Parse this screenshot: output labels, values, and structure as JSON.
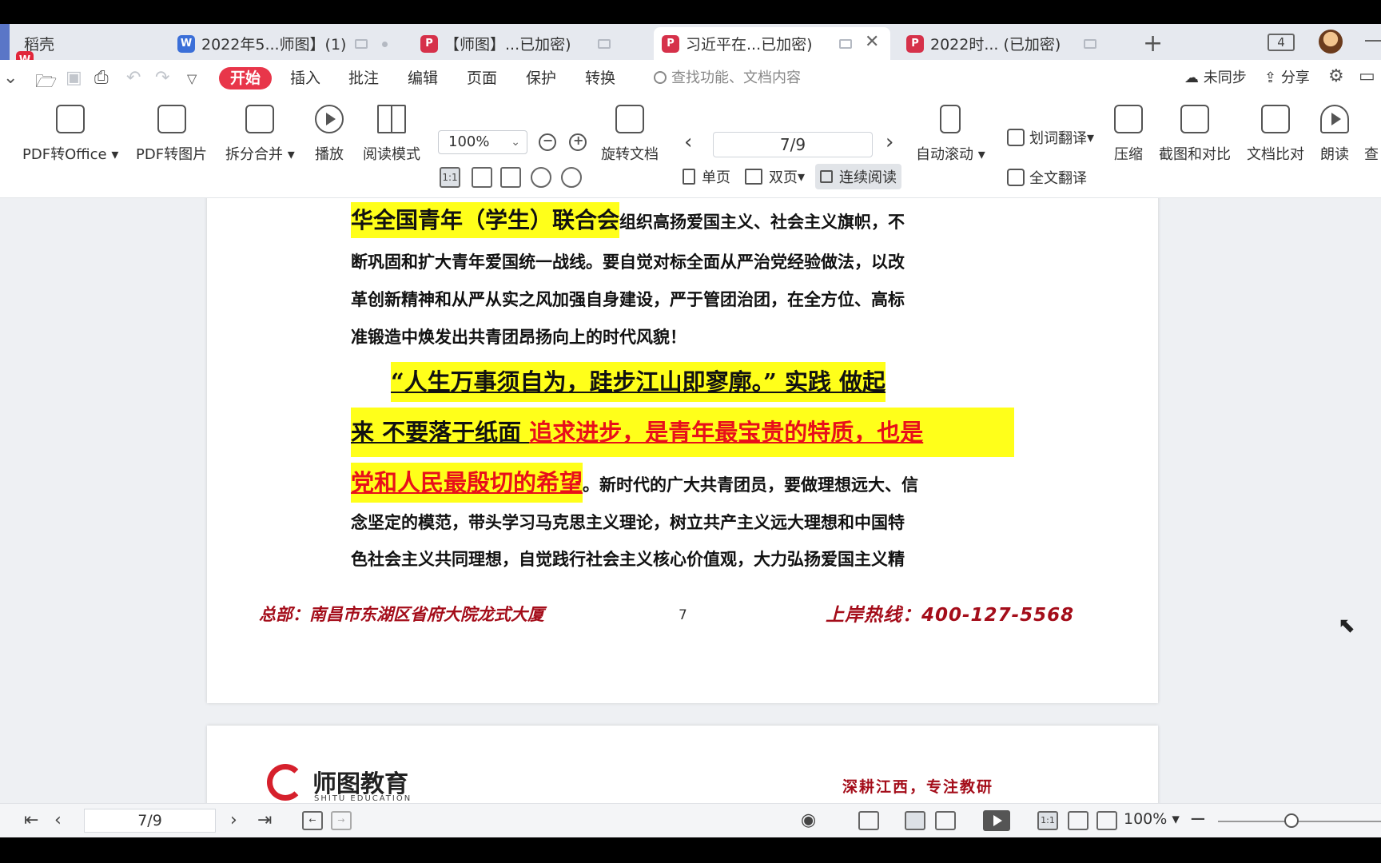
{
  "tabs": [
    {
      "label": "稻壳",
      "icon": "daoke-app-icon"
    },
    {
      "label": "2022年5...师图】(1)",
      "icon": "word-doc-icon"
    },
    {
      "label": "【师图】...已加密)",
      "icon": "pdf-icon"
    },
    {
      "label": "习近平在...已加密)",
      "icon": "pdf-icon",
      "active": true
    },
    {
      "label": "2022时... (已加密)",
      "icon": "pdf-icon"
    }
  ],
  "window": {
    "tab_count": "4"
  },
  "menu": {
    "items": [
      "开始",
      "插入",
      "批注",
      "编辑",
      "页面",
      "保护",
      "转换"
    ],
    "active": "开始",
    "search_placeholder": "查找功能、文档内容",
    "sync_label": "未同步",
    "share_label": "分享"
  },
  "ribbon": {
    "pdf_to_office": "PDF转Office",
    "pdf_to_image": "PDF转图片",
    "split_merge": "拆分合并",
    "play": "播放",
    "read_mode": "阅读模式",
    "zoom": "100%",
    "actual_size": "1:1",
    "rotate_doc": "旋转文档",
    "page_indicator": "7/9",
    "single_page": "单页",
    "double_page": "双页",
    "continuous_read": "连续阅读",
    "auto_scroll": "自动滚动",
    "word_translate": "划词翻译",
    "full_translate": "全文翻译",
    "compress": "压缩",
    "screenshot_compare": "截图和对比",
    "doc_compare": "文档比对",
    "read_aloud": "朗读",
    "more_cut": "查"
  },
  "document": {
    "lines": [
      {
        "segments": [
          {
            "text": "华全国青年（学生）联合会",
            "style": "hl big"
          },
          {
            "text": "组织高扬爱国主义、社会主义旗帜，不",
            "style": "normal"
          }
        ]
      },
      {
        "segments": [
          {
            "text": "断巩固和扩大青年爱国统一战线。要自觉对标全面从严治党经验做法，以改",
            "style": "normal"
          }
        ]
      },
      {
        "segments": [
          {
            "text": "革创新精神和从严从实之风加强自身建设，严于管团治团，在全方位、高标",
            "style": "normal"
          }
        ]
      },
      {
        "segments": [
          {
            "text": "准锻造中焕发出共青团昂扬向上的时代风貌！",
            "style": "normal"
          }
        ]
      },
      {
        "segments": [
          {
            "text": "“人生万事须自为，跬步江山即寥廓。”  实践 做起",
            "style": "hl big ul"
          }
        ]
      },
      {
        "segments": [
          {
            "text": "来 不要落于纸面 ",
            "style": "hl big ul"
          },
          {
            "text": "追求进步，是青年最宝贵的特质，也是",
            "style": "hl big ul red"
          }
        ]
      },
      {
        "segments": [
          {
            "text": "党和人民最殷切的希望",
            "style": "hl big ul red"
          },
          {
            "text": "。新时代的广大共青团员，要做理想远大、信",
            "style": "normal"
          }
        ]
      },
      {
        "segments": [
          {
            "text": "念坚定的模范，带头学习马克思主义理论，树立共产主义远大理想和中国特",
            "style": "normal"
          }
        ]
      },
      {
        "segments": [
          {
            "text": "色社会主义共同理想，自觉践行社会主义核心价值观，大力弘扬爱国主义精",
            "style": "normal"
          }
        ]
      }
    ],
    "footer_left": "总部：南昌市东湖区省府大院龙式大厦",
    "page_number": "7",
    "footer_right": "上岸热线：400-127-5568",
    "next_page_logo": "师图教育",
    "next_page_logo_sub": "SHITU EDUCATION",
    "next_page_slogan": "深耕江西，专注教研"
  },
  "statusbar": {
    "page_indicator": "7/9",
    "zoom": "100%",
    "zoom_level": 0.45
  },
  "colors": {
    "accent": "#e8364a",
    "highlight": "#ffff1a",
    "footer_red": "#a40d1a"
  }
}
